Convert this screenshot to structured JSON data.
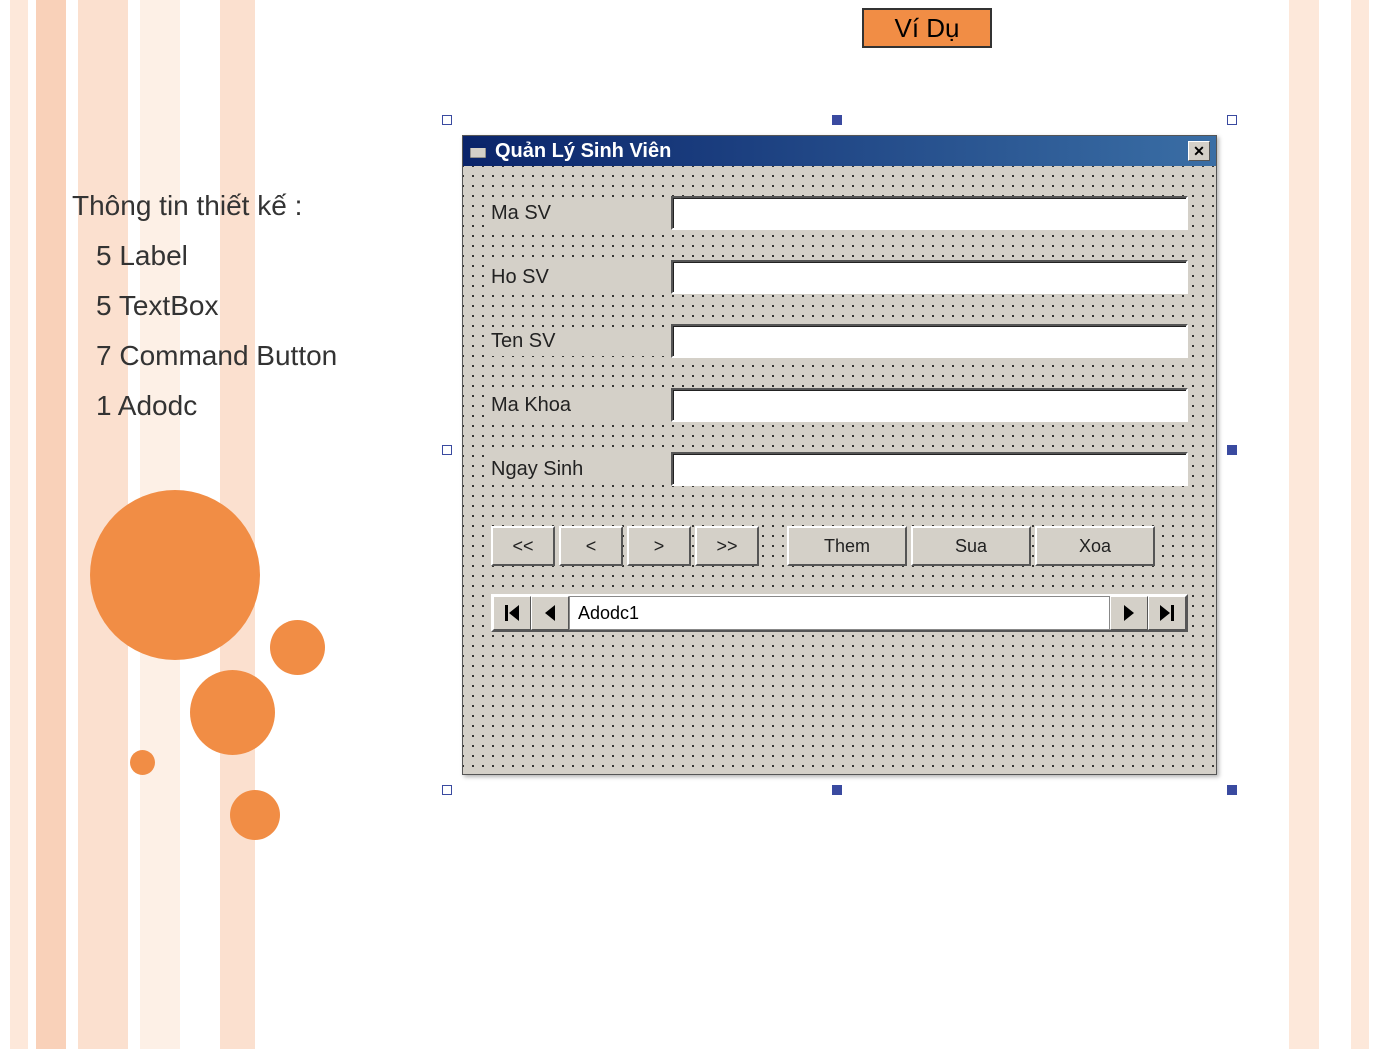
{
  "badge": {
    "label": "Ví Dụ"
  },
  "design_info": {
    "header": "Thông tin thiết kế :",
    "items": [
      "5 Label",
      "5 TextBox",
      "7 Command Button",
      "1 Adodc"
    ]
  },
  "form": {
    "title": "Quản Lý Sinh Viên",
    "fields": [
      {
        "label": "Ma SV",
        "value": ""
      },
      {
        "label": "Ho SV",
        "value": ""
      },
      {
        "label": "Ten SV",
        "value": ""
      },
      {
        "label": "Ma Khoa",
        "value": ""
      },
      {
        "label": "Ngay Sinh",
        "value": ""
      }
    ],
    "nav_buttons": [
      "<<",
      "<",
      ">",
      ">>"
    ],
    "action_buttons": [
      "Them",
      "Sua",
      "Xoa"
    ],
    "adodc_caption": "Adodc1"
  }
}
